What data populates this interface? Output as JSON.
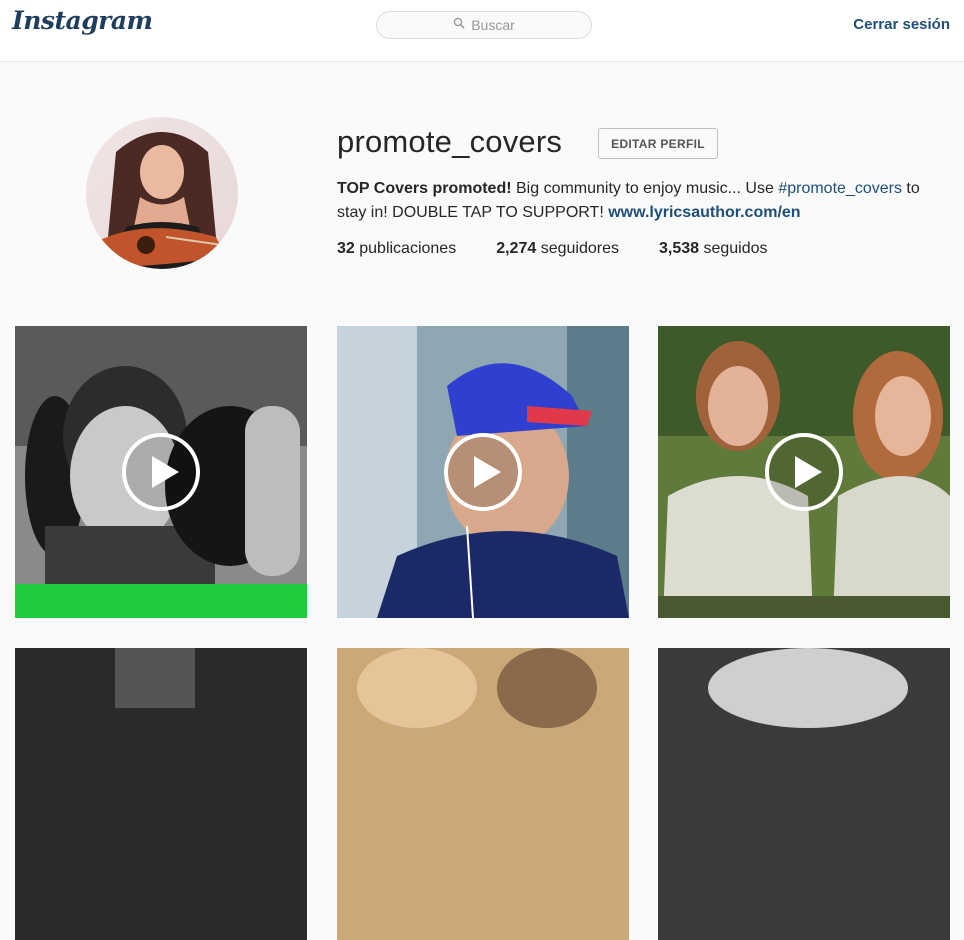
{
  "header": {
    "logo_text": "Instagram",
    "search_placeholder": "Buscar",
    "search_icon": "magnifier-icon",
    "logout_label": "Cerrar sesión"
  },
  "profile": {
    "username": "promote_covers",
    "edit_button_label": "EDITAR PERFIL",
    "bio": {
      "bold_intro": "TOP Covers promoted!",
      "text_1": " Big community to enjoy music... Use ",
      "hashtag": "#promote_covers",
      "text_2": " to stay in! DOUBLE TAP TO SUPPORT! ",
      "link": "www.lyricsauthor.com/en"
    },
    "stats": {
      "posts_count": "32",
      "posts_label": "publicaciones",
      "followers_count": "2,274",
      "followers_label": "seguidores",
      "following_count": "3,538",
      "following_label": "seguidos"
    }
  },
  "grid": {
    "posts": [
      {
        "type": "video",
        "icon": "play-icon"
      },
      {
        "type": "video",
        "icon": "play-icon"
      },
      {
        "type": "video",
        "icon": "play-icon"
      },
      {
        "type": "photo"
      },
      {
        "type": "photo"
      },
      {
        "type": "photo"
      }
    ]
  },
  "colors": {
    "link_blue": "#1f4e79",
    "background": "#fafafa",
    "header_bg": "#ffffff"
  }
}
